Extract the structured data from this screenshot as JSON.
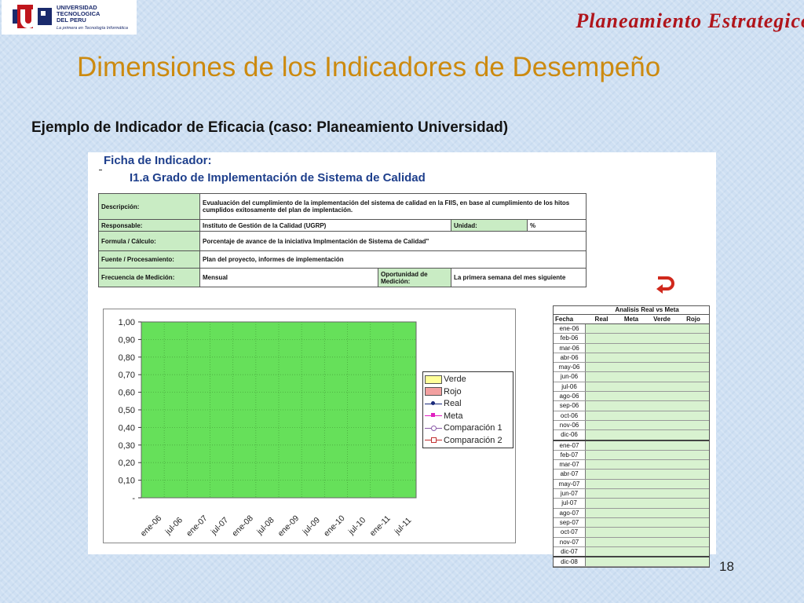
{
  "header": {
    "logo_line1": "UNIVERSIDAD",
    "logo_line2": "TECNOLOGICA",
    "logo_line3": "DEL PERU",
    "logo_tagline": "La primera en Tecnología Informática",
    "title": "Planeamiento Estrategico"
  },
  "slide": {
    "title": "Dimensiones de los Indicadores de Desempeño",
    "subtitle": "Ejemplo de Indicador de Eficacia (caso: Planeamiento Universidad)",
    "page_number": "18"
  },
  "sheet": {
    "ficha_label": "Ficha de Indicador:",
    "indicator_title": "I1.a Grado de Implementación de Sistema de Calidad",
    "rows": {
      "descripcion_label": "Descripción:",
      "descripcion_value": "Evualuación del cumplimiento de la implementación del sistema de calidad en la FIIS, en base al cumplimiento de los hitos cumplidos exitosamente del plan de implentación.",
      "responsable_label": "Responsable:",
      "responsable_value": "Instituto de Gestión de la Calidad (UGRP)",
      "unidad_label": "Unidad:",
      "unidad_value": "%",
      "formula_label": "Formula / Cálculo:",
      "formula_value": "Porcentaje de avance de la iniciativa Implmentación de Sistema de Calidad\"",
      "fuente_label": "Fuente / Procesamiento:",
      "fuente_value": "Plan del proyecto, informes de implementación",
      "frecuencia_label": "Frecuencia de Medición:",
      "frecuencia_value": "Mensual",
      "oportunidad_label": "Oportunidad de Medición:",
      "oportunidad_value": "La primera semana del mes siguiente"
    }
  },
  "chart_data": {
    "type": "area",
    "y_ticks": [
      "1,00",
      "0,90",
      "0,80",
      "0,70",
      "0,60",
      "0,50",
      "0,40",
      "0,30",
      "0,20",
      "0,10",
      "-"
    ],
    "ylim": [
      0,
      1
    ],
    "x_ticks": [
      "ene-06",
      "jul-06",
      "ene-07",
      "jul-07",
      "ene-08",
      "jul-08",
      "ene-09",
      "jul-09",
      "ene-10",
      "jul-10",
      "ene-11",
      "jul-11"
    ],
    "grid": true,
    "series": [
      {
        "name": "Verde",
        "color": "#66e05a"
      },
      {
        "name": "Rojo",
        "color": "#f2a0a0"
      },
      {
        "name": "Real",
        "color": "#1a2a7a"
      },
      {
        "name": "Meta",
        "color": "#e020c0"
      },
      {
        "name": "Comparación 1",
        "color": "#8a5aa8"
      },
      {
        "name": "Comparación 2",
        "color": "#c03030"
      }
    ],
    "legend_position": "right",
    "fill_color": "#66e05a"
  },
  "analysis_table": {
    "title": "Analisis Real vs Meta",
    "columns": [
      "Fecha",
      "Real",
      "Meta",
      "Verde",
      "Rojo"
    ],
    "dates": [
      "ene-06",
      "feb-06",
      "mar-06",
      "abr-06",
      "may-06",
      "jun-06",
      "jul-06",
      "ago-06",
      "sep-06",
      "oct-06",
      "nov-06",
      "dic-06",
      "ene-07",
      "feb-07",
      "mar-07",
      "abr-07",
      "may-07",
      "jun-07",
      "jul-07",
      "ago-07",
      "sep-07",
      "oct-07",
      "nov-07",
      "dic-07",
      "dic-08"
    ]
  }
}
